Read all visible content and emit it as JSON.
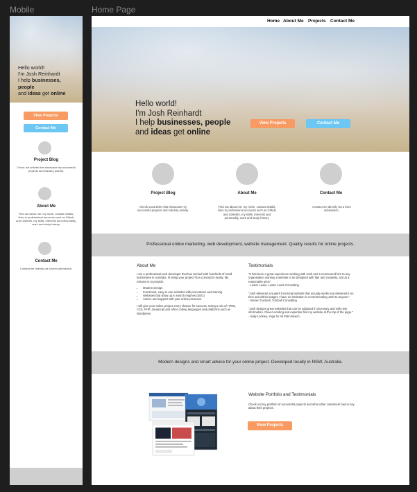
{
  "canvas": {
    "mobile_label": "Mobile",
    "desktop_label": "Home Page"
  },
  "colors": {
    "orange_button": "#f79b62",
    "blue_button": "#6cc7f2",
    "gray_band": "#cfcfcf",
    "canvas_bg": "#1e1e1e"
  },
  "hero": {
    "line1": "Hello world!",
    "line2": "I'm Josh Reinhardt",
    "line3_prefix": "I help ",
    "line3_bold": "businesses, people",
    "line4_prefix": "and ",
    "line4_bold1": "ideas",
    "line4_mid": " get ",
    "line4_bold2": "online",
    "mobile_line3_bold": "businesses,",
    "mobile_line4_bold": "people"
  },
  "buttons": {
    "view_projects": "View Projects",
    "contact_me": "Contact Me"
  },
  "nav": {
    "home": "Home",
    "about": "About Me",
    "projects": "Projects",
    "contact": "Contact Me"
  },
  "cards": [
    {
      "title": "Project Blog",
      "icon": "placeholder-circle",
      "text": "Check out articles that showcase my successful projects and industry activity."
    },
    {
      "title": "About Me",
      "icon": "placeholder-circle",
      "text": "Find out about me: my niche, contact details, links to professional accounts such as Github and LinkedIn, my skills, interests and personality, work and study history."
    },
    {
      "title": "Contact Me",
      "icon": "placeholder-circle",
      "text": "Contact me directly via a form submission."
    }
  ],
  "band1": "Professional online marketing, web development, website management. Quality results for online projects.",
  "about": {
    "title": "About Me",
    "intro": "I am a professional web developer that has worked with hundreds of small businesses in Australia. Ill being your project from concept to reality. My mission is to provide:",
    "bullets": [
      "Modern Design",
      "Functional, easy to use websites with procedures and training",
      "Websites that show up in search engines (SEO)",
      "Advice and support with your online presence"
    ],
    "outro": "I will give your online project every chance for success. Using a mix of HTML, CSS, PHP, Javascript and other coding languages and platforms such as Wordpress."
  },
  "testimonials": {
    "title": "Testimonials",
    "items": [
      {
        "quote": "\"It has been a great experience working with Josh and I recommend him to any organisation wanting a website to be designed with flair and creativity, and at a reasonable price\"",
        "author": "- Lester Lewis, Lester Lewis Consulting"
      },
      {
        "quote": "\"Josh delivered a superb functional website that actually works and delivered it on time and within budget. I have no hesitation in recommending Josh to anyone.\"",
        "author": "- Steven Turnbull, Turnbull Consulting"
      },
      {
        "quote": "\"Josh designs great websites that can be adjusted if necessary and with new information. Clever wording and expertise find my website at the top of the page.\"",
        "author": "- Sally Lockley, Yoga for All Palm Beach"
      }
    ]
  },
  "band2": "Modern designs and smart advice for your online project. Developed locally in NSW, Australia.",
  "portfolio": {
    "title": "Website Portfolio and Testimonials",
    "text": "Check out my portfolio of successful projects and what other customers had to say about their projects.",
    "button": "View Projects"
  }
}
